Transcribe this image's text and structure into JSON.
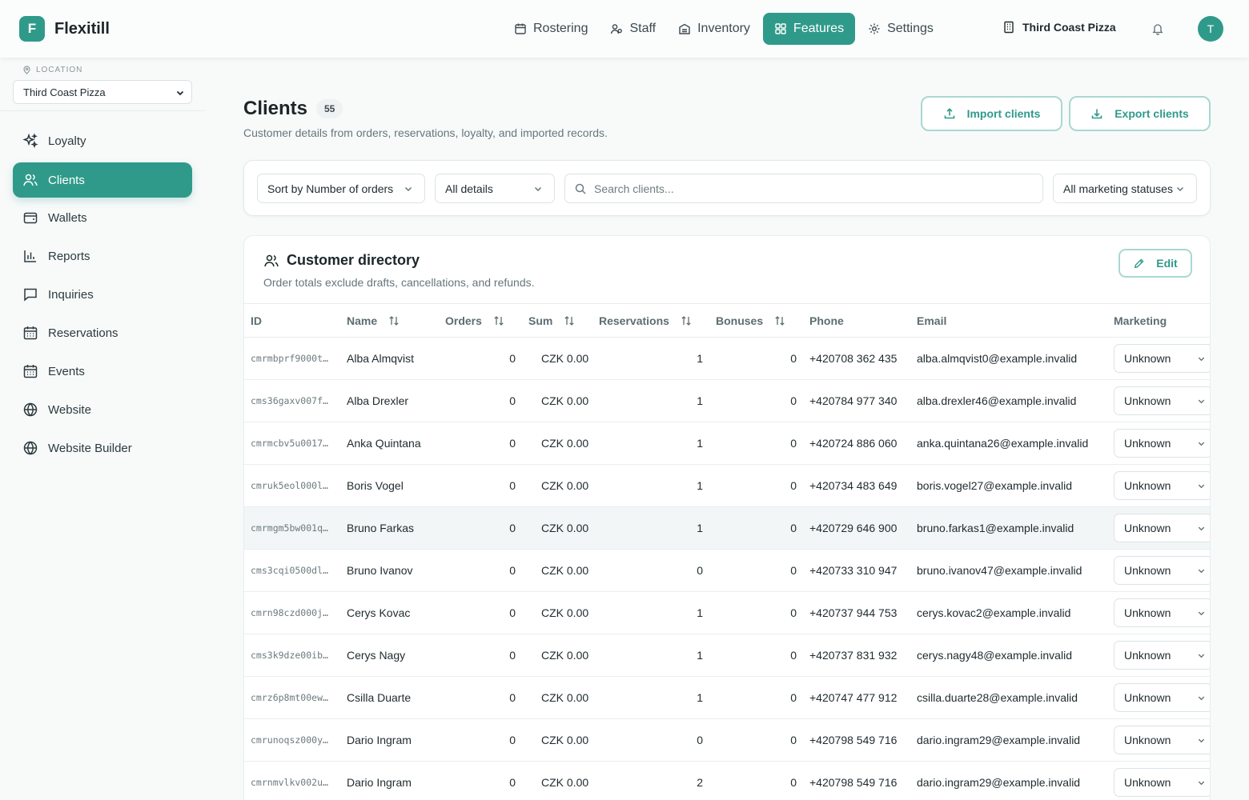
{
  "brand": {
    "letter": "F",
    "name": "Flexitill"
  },
  "topnav": [
    {
      "label": "Rostering",
      "icon": "calendar-icon"
    },
    {
      "label": "Staff",
      "icon": "staff-icon"
    },
    {
      "label": "Inventory",
      "icon": "inventory-icon"
    },
    {
      "label": "Features",
      "icon": "grid-icon",
      "active": true
    },
    {
      "label": "Settings",
      "icon": "gear-icon"
    }
  ],
  "top_location": "Third Coast Pizza",
  "avatar_letter": "T",
  "sidebar": {
    "location_label": "LOCATION",
    "location_value": "Third Coast Pizza",
    "items": [
      {
        "label": "Loyalty",
        "icon": "sparkles-icon"
      },
      {
        "label": "Clients",
        "icon": "users-icon",
        "active": true
      },
      {
        "label": "Wallets",
        "icon": "wallet-icon"
      },
      {
        "label": "Reports",
        "icon": "bar-chart-icon"
      },
      {
        "label": "Inquiries",
        "icon": "message-icon"
      },
      {
        "label": "Reservations",
        "icon": "calendar-icon"
      },
      {
        "label": "Events",
        "icon": "calendar-icon"
      },
      {
        "label": "Website",
        "icon": "globe-icon"
      },
      {
        "label": "Website Builder",
        "icon": "globe-icon"
      }
    ]
  },
  "page": {
    "title": "Clients",
    "count": "55",
    "subtitle": "Customer details from orders, reservations, loyalty, and imported records.",
    "import_label": "Import clients",
    "export_label": "Export clients"
  },
  "filters": {
    "sort": "Sort by Number of orders",
    "details": "All details",
    "search_placeholder": "Search clients...",
    "marketing": "All marketing statuses"
  },
  "directory": {
    "title": "Customer directory",
    "subtitle": "Order totals exclude drafts, cancellations, and refunds.",
    "edit_label": "Edit",
    "columns": [
      "ID",
      "Name",
      "Orders",
      "Sum",
      "Reservations",
      "Bonuses",
      "Phone",
      "Email",
      "Marketing"
    ],
    "rows": [
      {
        "id": "cmrmbprf9000t…",
        "name": "Alba Almqvist",
        "orders": "0",
        "sum": "CZK 0.00",
        "reservations": "1",
        "bonuses": "0",
        "phone": "+420708 362 435",
        "email": "alba.almqvist0@example.invalid",
        "marketing": "Unknown"
      },
      {
        "id": "cms36gaxv007f…",
        "name": "Alba Drexler",
        "orders": "0",
        "sum": "CZK 0.00",
        "reservations": "1",
        "bonuses": "0",
        "phone": "+420784 977 340",
        "email": "alba.drexler46@example.invalid",
        "marketing": "Unknown"
      },
      {
        "id": "cmrmcbv5u0017…",
        "name": "Anka Quintana",
        "orders": "0",
        "sum": "CZK 0.00",
        "reservations": "1",
        "bonuses": "0",
        "phone": "+420724 886 060",
        "email": "anka.quintana26@example.invalid",
        "marketing": "Unknown"
      },
      {
        "id": "cmruk5eol000l…",
        "name": "Boris Vogel",
        "orders": "0",
        "sum": "CZK 0.00",
        "reservations": "1",
        "bonuses": "0",
        "phone": "+420734 483 649",
        "email": "boris.vogel27@example.invalid",
        "marketing": "Unknown"
      },
      {
        "id": "cmrmgm5bw001q…",
        "name": "Bruno Farkas",
        "orders": "0",
        "sum": "CZK 0.00",
        "reservations": "1",
        "bonuses": "0",
        "phone": "+420729 646 900",
        "email": "bruno.farkas1@example.invalid",
        "marketing": "Unknown",
        "highlight": true
      },
      {
        "id": "cms3cqi0500dl…",
        "name": "Bruno Ivanov",
        "orders": "0",
        "sum": "CZK 0.00",
        "reservations": "0",
        "bonuses": "0",
        "phone": "+420733 310 947",
        "email": "bruno.ivanov47@example.invalid",
        "marketing": "Unknown"
      },
      {
        "id": "cmrn98czd000j…",
        "name": "Cerys Kovac",
        "orders": "0",
        "sum": "CZK 0.00",
        "reservations": "1",
        "bonuses": "0",
        "phone": "+420737 944 753",
        "email": "cerys.kovac2@example.invalid",
        "marketing": "Unknown"
      },
      {
        "id": "cms3k9dze00ib…",
        "name": "Cerys Nagy",
        "orders": "0",
        "sum": "CZK 0.00",
        "reservations": "1",
        "bonuses": "0",
        "phone": "+420737 831 932",
        "email": "cerys.nagy48@example.invalid",
        "marketing": "Unknown"
      },
      {
        "id": "cmrz6p8mt00ew…",
        "name": "Csilla Duarte",
        "orders": "0",
        "sum": "CZK 0.00",
        "reservations": "1",
        "bonuses": "0",
        "phone": "+420747 477 912",
        "email": "csilla.duarte28@example.invalid",
        "marketing": "Unknown"
      },
      {
        "id": "cmrunoqsz000y…",
        "name": "Dario Ingram",
        "orders": "0",
        "sum": "CZK 0.00",
        "reservations": "0",
        "bonuses": "0",
        "phone": "+420798 549 716",
        "email": "dario.ingram29@example.invalid",
        "marketing": "Unknown"
      },
      {
        "id": "cmrnmvlkv002u…",
        "name": "Dario Ingram",
        "orders": "0",
        "sum": "CZK 0.00",
        "reservations": "2",
        "bonuses": "0",
        "phone": "+420798 549 716",
        "email": "dario.ingram29@example.invalid",
        "marketing": "Unknown"
      }
    ]
  },
  "colors": {
    "accent": "#2f9a8a",
    "accent_border": "#a9d8d0",
    "background": "#f8fafa"
  }
}
